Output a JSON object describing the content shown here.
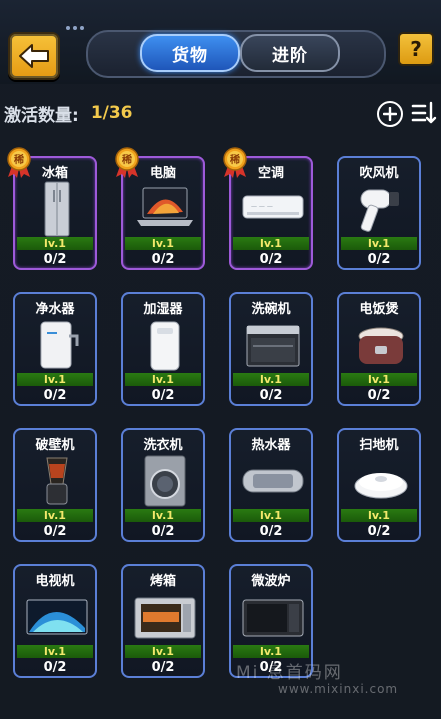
{
  "header": {
    "tabs": [
      {
        "label": "货物",
        "active": true
      },
      {
        "label": "进阶",
        "active": false
      }
    ],
    "help_label": "?",
    "back_icon": "back-arrow-icon"
  },
  "activation": {
    "label": "激活数量:",
    "value": "1/36"
  },
  "colors": {
    "accent_gold": "#f2c94c",
    "active_border": "#9e5ad9",
    "inactive_border": "#5b7fd6",
    "level_bar": "#2a7a12",
    "level_text": "#f2e86b",
    "tab_active": "#2f74d6"
  },
  "items": [
    {
      "name": "冰箱",
      "level": "lv.1",
      "count": "0/2",
      "active": true,
      "icon": "refrigerator-icon",
      "badge": "稀"
    },
    {
      "name": "电脑",
      "level": "lv.1",
      "count": "0/2",
      "active": true,
      "icon": "laptop-icon",
      "badge": "稀"
    },
    {
      "name": "空调",
      "level": "lv.1",
      "count": "0/2",
      "active": true,
      "icon": "air-conditioner-icon",
      "badge": "稀"
    },
    {
      "name": "吹风机",
      "level": "lv.1",
      "count": "0/2",
      "active": false,
      "icon": "hair-dryer-icon"
    },
    {
      "name": "净水器",
      "level": "lv.1",
      "count": "0/2",
      "active": false,
      "icon": "water-purifier-icon"
    },
    {
      "name": "加湿器",
      "level": "lv.1",
      "count": "0/2",
      "active": false,
      "icon": "humidifier-icon"
    },
    {
      "name": "洗碗机",
      "level": "lv.1",
      "count": "0/2",
      "active": false,
      "icon": "dishwasher-icon"
    },
    {
      "name": "电饭煲",
      "level": "lv.1",
      "count": "0/2",
      "active": false,
      "icon": "rice-cooker-icon"
    },
    {
      "name": "破壁机",
      "level": "lv.1",
      "count": "0/2",
      "active": false,
      "icon": "blender-icon"
    },
    {
      "name": "洗衣机",
      "level": "lv.1",
      "count": "0/2",
      "active": false,
      "icon": "washing-machine-icon"
    },
    {
      "name": "热水器",
      "level": "lv.1",
      "count": "0/2",
      "active": false,
      "icon": "water-heater-icon"
    },
    {
      "name": "扫地机",
      "level": "lv.1",
      "count": "0/2",
      "active": false,
      "icon": "robot-vacuum-icon"
    },
    {
      "name": "电视机",
      "level": "lv.1",
      "count": "0/2",
      "active": false,
      "icon": "television-icon"
    },
    {
      "name": "烤箱",
      "level": "lv.1",
      "count": "0/2",
      "active": false,
      "icon": "oven-icon"
    },
    {
      "name": "微波炉",
      "level": "lv.1",
      "count": "0/2",
      "active": false,
      "icon": "microwave-icon"
    }
  ],
  "watermark": {
    "line1": "Mi 息首码网",
    "line2": "www.mixinxi.com"
  }
}
